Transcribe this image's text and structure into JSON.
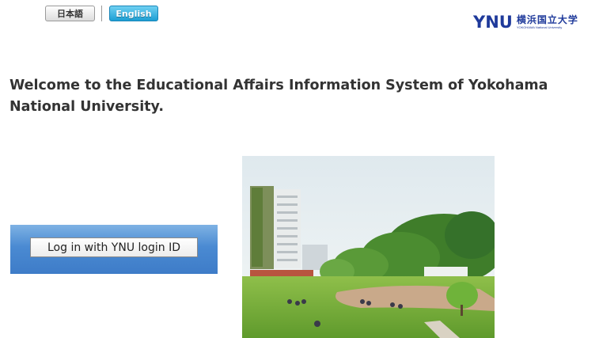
{
  "language": {
    "japanese_label": "日本語",
    "english_label": "English",
    "selected": "English"
  },
  "logo": {
    "mark": "YNU",
    "name_ja": "横浜国立大学",
    "name_en": "YOKOHAMA National University"
  },
  "main": {
    "welcome_line1": "Welcome to the Educational Affairs Information System of Yokohama",
    "welcome_line2": "National University."
  },
  "login": {
    "button_label": "Log in with YNU login ID"
  },
  "colors": {
    "brand": "#1f3a9b",
    "login_panel": "#4a8ad2",
    "english_button": "#1d9fd4"
  }
}
